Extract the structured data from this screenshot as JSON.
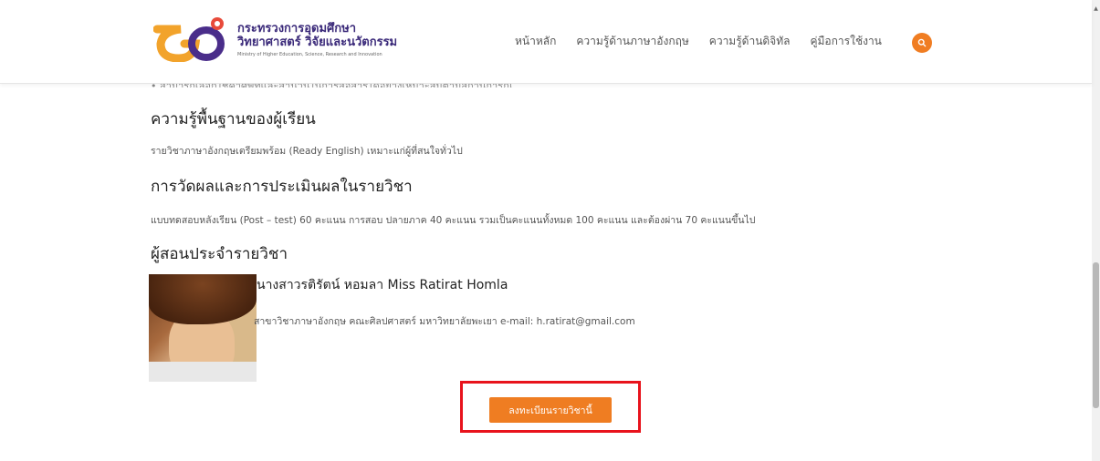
{
  "header": {
    "logo_line1": "กระทรวงการอุดมศึกษา",
    "logo_line2": "วิทยาศาสตร์ วิจัยและนวัตกรรม",
    "logo_line3": "Ministry of Higher Education, Science, Research and Innovation",
    "nav": [
      "หน้าหลัก",
      "ความรู้ด้านภาษาอังกฤษ",
      "ความรู้ด้านดิจิทัล",
      "คู่มือการใช้งาน"
    ],
    "accent_color": "#f07d22"
  },
  "clipped_text": "• สามารถเลือกใช้คำศัพท์และสำนวนในการสื่อสารได้อย่างเหมาะสมตามสถานการณ์",
  "sections": {
    "background_title": "ความรู้พื้นฐานของผู้เรียน",
    "background_text": "รายวิชาภาษาอังกฤษเตรียมพร้อม (Ready English) เหมาะแก่ผู้ที่สนใจทั่วไป",
    "evaluation_title": "การวัดผลและการประเมินผลในรายวิชา",
    "evaluation_text": "แบบทดสอบหลังเรียน (Post – test) 60 คะแนน การสอบ ปลายภาค 40 คะแนน รวมเป็นคะแนนทั้งหมด 100 คะแนน และต้องผ่าน 70 คะแนนขึ้นไป",
    "instructor_title": "ผู้สอนประจำรายวิชา"
  },
  "instructor": {
    "name": "นางสาวรติรัตน์ หอมลา Miss Ratirat Homla",
    "info": "สาขาวิชาภาษาอังกฤษ คณะศิลปศาสตร์ มหาวิทยาลัยพะเยา e-mail: h.ratirat@gmail.com"
  },
  "enroll_button": "ลงทะเบียนรายวิชานี้",
  "colors": {
    "button": "#ef7d22",
    "highlight_box": "#e8131c"
  }
}
